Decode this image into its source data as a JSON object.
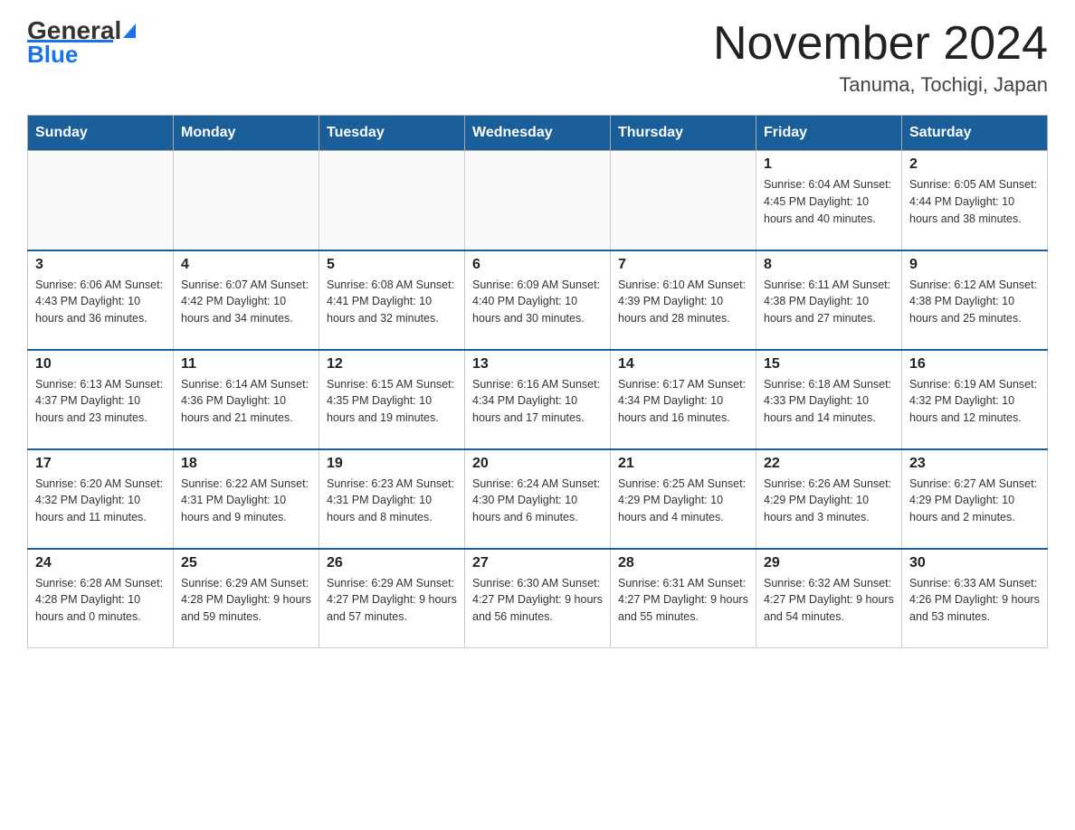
{
  "header": {
    "logo_text_general": "General",
    "logo_text_blue": "Blue",
    "title": "November 2024",
    "subtitle": "Tanuma, Tochigi, Japan"
  },
  "days_of_week": [
    "Sunday",
    "Monday",
    "Tuesday",
    "Wednesday",
    "Thursday",
    "Friday",
    "Saturday"
  ],
  "weeks": [
    [
      {
        "day": "",
        "info": ""
      },
      {
        "day": "",
        "info": ""
      },
      {
        "day": "",
        "info": ""
      },
      {
        "day": "",
        "info": ""
      },
      {
        "day": "",
        "info": ""
      },
      {
        "day": "1",
        "info": "Sunrise: 6:04 AM\nSunset: 4:45 PM\nDaylight: 10 hours\nand 40 minutes."
      },
      {
        "day": "2",
        "info": "Sunrise: 6:05 AM\nSunset: 4:44 PM\nDaylight: 10 hours\nand 38 minutes."
      }
    ],
    [
      {
        "day": "3",
        "info": "Sunrise: 6:06 AM\nSunset: 4:43 PM\nDaylight: 10 hours\nand 36 minutes."
      },
      {
        "day": "4",
        "info": "Sunrise: 6:07 AM\nSunset: 4:42 PM\nDaylight: 10 hours\nand 34 minutes."
      },
      {
        "day": "5",
        "info": "Sunrise: 6:08 AM\nSunset: 4:41 PM\nDaylight: 10 hours\nand 32 minutes."
      },
      {
        "day": "6",
        "info": "Sunrise: 6:09 AM\nSunset: 4:40 PM\nDaylight: 10 hours\nand 30 minutes."
      },
      {
        "day": "7",
        "info": "Sunrise: 6:10 AM\nSunset: 4:39 PM\nDaylight: 10 hours\nand 28 minutes."
      },
      {
        "day": "8",
        "info": "Sunrise: 6:11 AM\nSunset: 4:38 PM\nDaylight: 10 hours\nand 27 minutes."
      },
      {
        "day": "9",
        "info": "Sunrise: 6:12 AM\nSunset: 4:38 PM\nDaylight: 10 hours\nand 25 minutes."
      }
    ],
    [
      {
        "day": "10",
        "info": "Sunrise: 6:13 AM\nSunset: 4:37 PM\nDaylight: 10 hours\nand 23 minutes."
      },
      {
        "day": "11",
        "info": "Sunrise: 6:14 AM\nSunset: 4:36 PM\nDaylight: 10 hours\nand 21 minutes."
      },
      {
        "day": "12",
        "info": "Sunrise: 6:15 AM\nSunset: 4:35 PM\nDaylight: 10 hours\nand 19 minutes."
      },
      {
        "day": "13",
        "info": "Sunrise: 6:16 AM\nSunset: 4:34 PM\nDaylight: 10 hours\nand 17 minutes."
      },
      {
        "day": "14",
        "info": "Sunrise: 6:17 AM\nSunset: 4:34 PM\nDaylight: 10 hours\nand 16 minutes."
      },
      {
        "day": "15",
        "info": "Sunrise: 6:18 AM\nSunset: 4:33 PM\nDaylight: 10 hours\nand 14 minutes."
      },
      {
        "day": "16",
        "info": "Sunrise: 6:19 AM\nSunset: 4:32 PM\nDaylight: 10 hours\nand 12 minutes."
      }
    ],
    [
      {
        "day": "17",
        "info": "Sunrise: 6:20 AM\nSunset: 4:32 PM\nDaylight: 10 hours\nand 11 minutes."
      },
      {
        "day": "18",
        "info": "Sunrise: 6:22 AM\nSunset: 4:31 PM\nDaylight: 10 hours\nand 9 minutes."
      },
      {
        "day": "19",
        "info": "Sunrise: 6:23 AM\nSunset: 4:31 PM\nDaylight: 10 hours\nand 8 minutes."
      },
      {
        "day": "20",
        "info": "Sunrise: 6:24 AM\nSunset: 4:30 PM\nDaylight: 10 hours\nand 6 minutes."
      },
      {
        "day": "21",
        "info": "Sunrise: 6:25 AM\nSunset: 4:29 PM\nDaylight: 10 hours\nand 4 minutes."
      },
      {
        "day": "22",
        "info": "Sunrise: 6:26 AM\nSunset: 4:29 PM\nDaylight: 10 hours\nand 3 minutes."
      },
      {
        "day": "23",
        "info": "Sunrise: 6:27 AM\nSunset: 4:29 PM\nDaylight: 10 hours\nand 2 minutes."
      }
    ],
    [
      {
        "day": "24",
        "info": "Sunrise: 6:28 AM\nSunset: 4:28 PM\nDaylight: 10 hours\nand 0 minutes."
      },
      {
        "day": "25",
        "info": "Sunrise: 6:29 AM\nSunset: 4:28 PM\nDaylight: 9 hours\nand 59 minutes."
      },
      {
        "day": "26",
        "info": "Sunrise: 6:29 AM\nSunset: 4:27 PM\nDaylight: 9 hours\nand 57 minutes."
      },
      {
        "day": "27",
        "info": "Sunrise: 6:30 AM\nSunset: 4:27 PM\nDaylight: 9 hours\nand 56 minutes."
      },
      {
        "day": "28",
        "info": "Sunrise: 6:31 AM\nSunset: 4:27 PM\nDaylight: 9 hours\nand 55 minutes."
      },
      {
        "day": "29",
        "info": "Sunrise: 6:32 AM\nSunset: 4:27 PM\nDaylight: 9 hours\nand 54 minutes."
      },
      {
        "day": "30",
        "info": "Sunrise: 6:33 AM\nSunset: 4:26 PM\nDaylight: 9 hours\nand 53 minutes."
      }
    ]
  ]
}
